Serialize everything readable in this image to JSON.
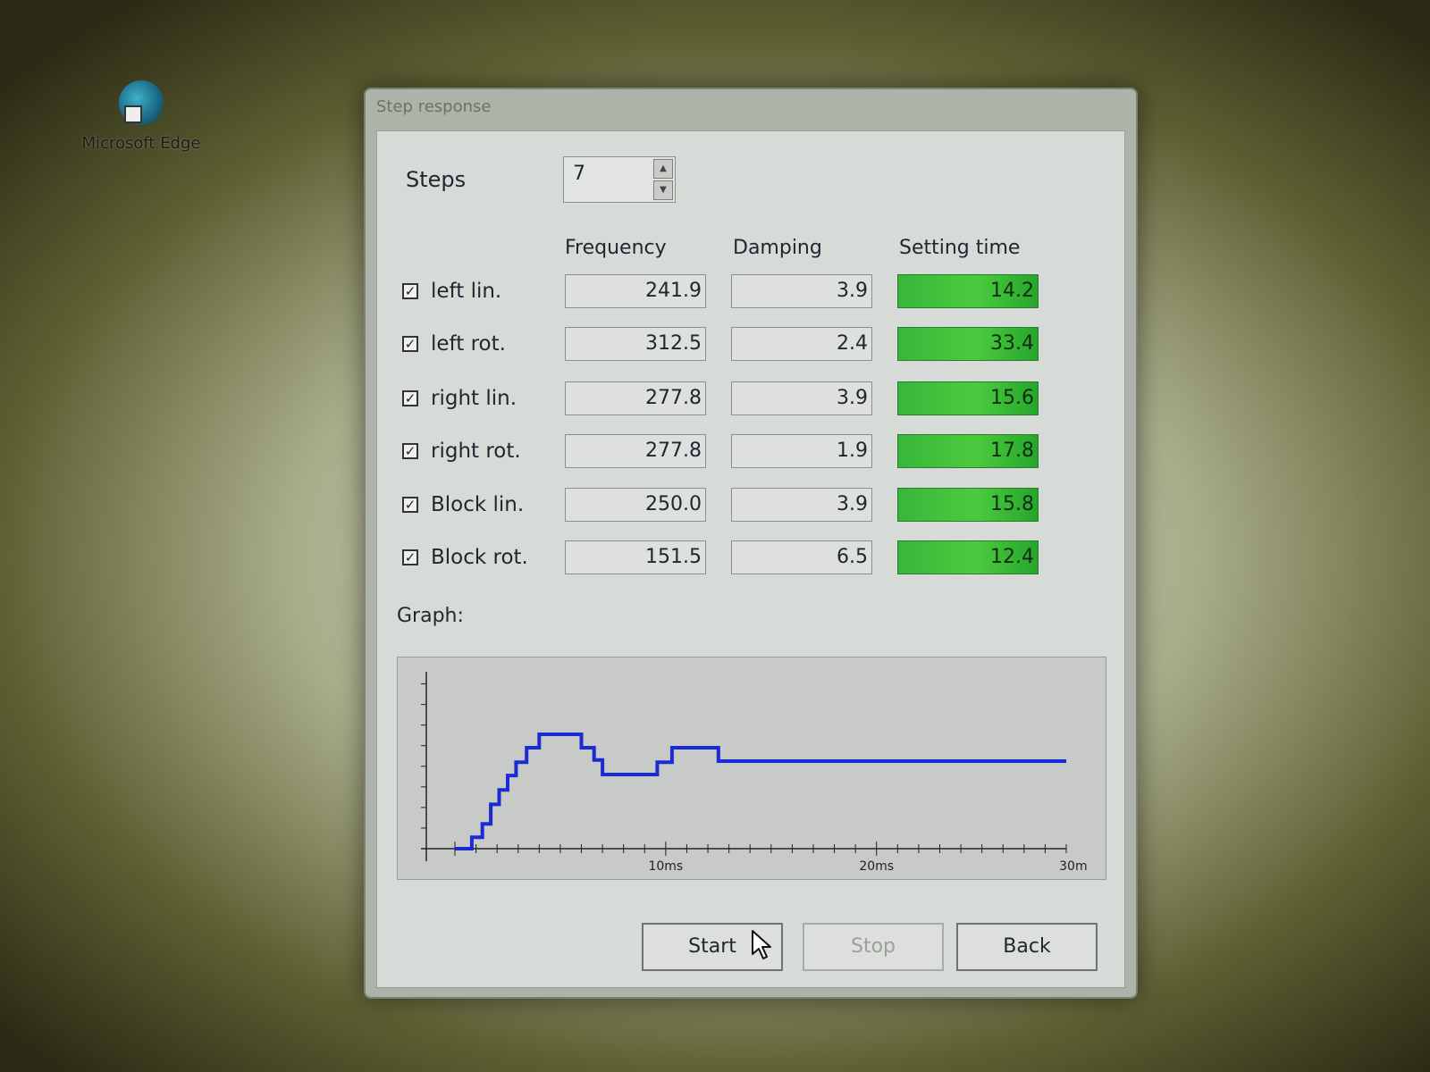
{
  "desktop": {
    "icon_label": "Microsoft Edge"
  },
  "window": {
    "title": "Step response",
    "steps_label": "Steps",
    "steps_value": "7",
    "columns": {
      "frequency": "Frequency",
      "damping": "Damping",
      "setting_time": "Setting time"
    },
    "rows": [
      {
        "label": "left lin.",
        "checked": true,
        "frequency": "241.9",
        "damping": "3.9",
        "setting_time": "14.2"
      },
      {
        "label": "left rot.",
        "checked": true,
        "frequency": "312.5",
        "damping": "2.4",
        "setting_time": "33.4"
      },
      {
        "label": "right lin.",
        "checked": true,
        "frequency": "277.8",
        "damping": "3.9",
        "setting_time": "15.6"
      },
      {
        "label": "right rot.",
        "checked": true,
        "frequency": "277.8",
        "damping": "1.9",
        "setting_time": "17.8"
      },
      {
        "label": "Block lin.",
        "checked": true,
        "frequency": "250.0",
        "damping": "3.9",
        "setting_time": "15.8"
      },
      {
        "label": "Block rot.",
        "checked": true,
        "frequency": "151.5",
        "damping": "6.5",
        "setting_time": "12.4"
      }
    ],
    "graph_label": "Graph:",
    "buttons": {
      "start": "Start",
      "stop": "Stop",
      "back": "Back"
    },
    "colors": {
      "setting_time_ok": "#3cbf3c",
      "graph_line": "#1a2bd6"
    }
  },
  "chart_data": {
    "type": "line",
    "x_tick_labels": [
      "10ms",
      "20ms",
      "30m"
    ],
    "xlim": [
      0,
      29
    ],
    "ylim": [
      0,
      8.5
    ],
    "step_shape": true,
    "series": [
      {
        "points": [
          [
            0,
            0
          ],
          [
            0.8,
            0
          ],
          [
            0.8,
            0.55
          ],
          [
            1.3,
            0.55
          ],
          [
            1.3,
            1.2
          ],
          [
            1.7,
            1.2
          ],
          [
            1.7,
            2.15
          ],
          [
            2.1,
            2.15
          ],
          [
            2.1,
            2.85
          ],
          [
            2.5,
            2.85
          ],
          [
            2.5,
            3.55
          ],
          [
            2.9,
            3.55
          ],
          [
            2.9,
            4.2
          ],
          [
            3.4,
            4.2
          ],
          [
            3.4,
            4.9
          ],
          [
            4.0,
            4.9
          ],
          [
            4.0,
            5.55
          ],
          [
            6.0,
            5.55
          ],
          [
            6.0,
            4.9
          ],
          [
            6.6,
            4.9
          ],
          [
            6.6,
            4.3
          ],
          [
            7.0,
            4.3
          ],
          [
            7.0,
            3.6
          ],
          [
            9.6,
            3.6
          ],
          [
            9.6,
            4.2
          ],
          [
            10.3,
            4.2
          ],
          [
            10.3,
            4.9
          ],
          [
            12.5,
            4.9
          ],
          [
            12.5,
            4.25
          ],
          [
            29,
            4.25
          ]
        ]
      }
    ],
    "grid": false
  }
}
